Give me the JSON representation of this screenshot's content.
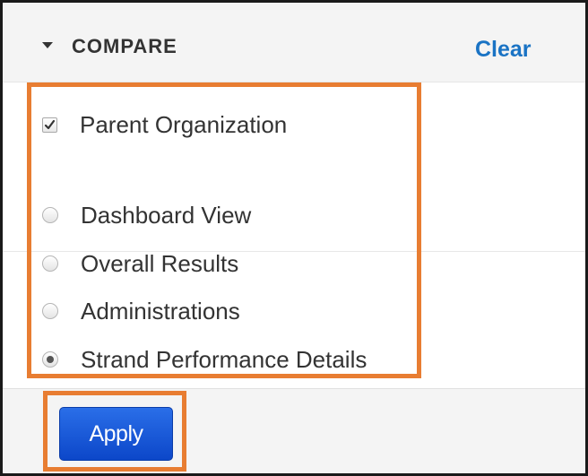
{
  "header": {
    "title": "COMPARE",
    "toggle_icon": "caret-down-icon",
    "clear_label": "Clear"
  },
  "options": {
    "parent_organization": {
      "label": "Parent Organization",
      "type": "checkbox",
      "checked": true
    },
    "views": [
      {
        "label": "Dashboard View",
        "type": "radio",
        "selected": false
      },
      {
        "label": "Overall Results",
        "type": "radio",
        "selected": false
      },
      {
        "label": "Administrations",
        "type": "radio",
        "selected": false
      },
      {
        "label": "Strand Performance Details",
        "type": "radio",
        "selected": true
      }
    ]
  },
  "footer": {
    "apply_label": "Apply"
  },
  "colors": {
    "accent_link": "#1a73c4",
    "apply_button": "#0c47c9",
    "highlight": "#e87d32",
    "header_background": "#f4f4f4"
  }
}
